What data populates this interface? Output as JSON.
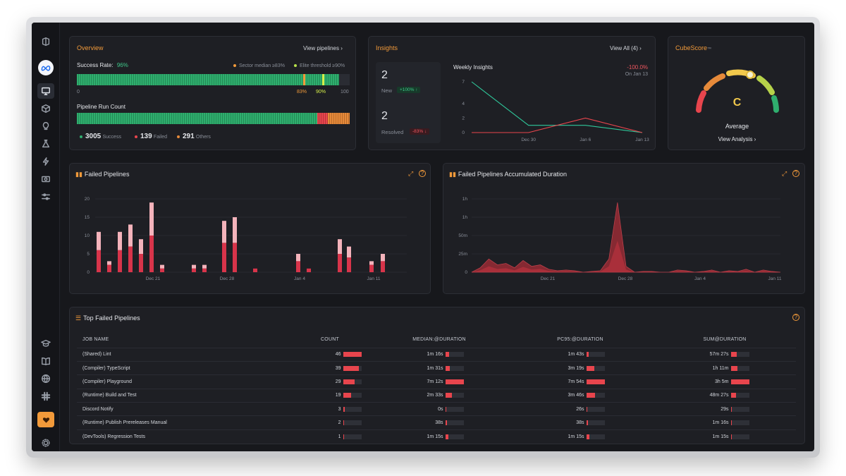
{
  "overview": {
    "title": "Overview",
    "view_link": "View pipelines",
    "success_label": "Success Rate:",
    "success_value": "96%",
    "sector_legend": "Sector median ≥83%",
    "elite_legend": "Elite threshold ≥90%",
    "axis_start": "0",
    "axis_83": "83%",
    "axis_90": "90%",
    "axis_end": "100",
    "run_count_label": "Pipeline Run Count",
    "success_count": "3005",
    "success_word": "Success",
    "failed_count": "139",
    "failed_word": "Failed",
    "other_count": "291",
    "other_word": "Others",
    "success_rate_fraction": 0.96,
    "run_share": {
      "success": 0.88,
      "failed": 0.04,
      "others": 0.08
    }
  },
  "insights": {
    "title": "Insights",
    "view_link": "View All (4)",
    "new_value": "2",
    "new_label": "New",
    "new_badge": "+100% ↑",
    "resolved_value": "2",
    "resolved_label": "Resolved",
    "resolved_badge": "-83% ↓",
    "chart_title": "Weekly Insights",
    "delta_value": "-100.0%",
    "delta_date": "On Jan 13"
  },
  "cubescore": {
    "title": "CubeScore",
    "title_suffix": "™",
    "grade": "C",
    "rating": "Average",
    "link": "View Analysis"
  },
  "failed_pipelines": {
    "title": "Failed Pipelines"
  },
  "accum_duration": {
    "title": "Failed Pipelines Accumulated Duration"
  },
  "top_failed": {
    "title": "Top Failed Pipelines",
    "headers": [
      "JOB NAME",
      "COUNT",
      "MEDIAN:@DURATION",
      "PC95:@DURATION",
      "SUM@DURATION"
    ],
    "rows": [
      {
        "name": "(Shared) Lint",
        "count": "46",
        "count_f": 1.0,
        "median": "1m 16s",
        "median_f": 0.2,
        "pc95": "1m 43s",
        "pc95_f": 0.1,
        "sum": "57m 27s",
        "sum_f": 0.3
      },
      {
        "name": "(Compiler) TypeScript",
        "count": "39",
        "count_f": 0.85,
        "median": "1m 31s",
        "median_f": 0.22,
        "pc95": "3m 19s",
        "pc95_f": 0.42,
        "sum": "1h 11m",
        "sum_f": 0.35
      },
      {
        "name": "(Compiler) Playground",
        "count": "29",
        "count_f": 0.63,
        "median": "7m 12s",
        "median_f": 1.0,
        "pc95": "7m 54s",
        "pc95_f": 1.0,
        "sum": "3h 5m",
        "sum_f": 1.0
      },
      {
        "name": "(Runtime) Build and Test",
        "count": "19",
        "count_f": 0.41,
        "median": "2m 33s",
        "median_f": 0.35,
        "pc95": "3m 46s",
        "pc95_f": 0.48,
        "sum": "48m 27s",
        "sum_f": 0.26
      },
      {
        "name": "Discord Notify",
        "count": "3",
        "count_f": 0.07,
        "median": "0s",
        "median_f": 0.0,
        "pc95": "26s",
        "pc95_f": 0.05,
        "sum": "29s",
        "sum_f": 0.01
      },
      {
        "name": "(Runtime) Publish Prereleases Manual",
        "count": "2",
        "count_f": 0.05,
        "median": "38s",
        "median_f": 0.09,
        "pc95": "38s",
        "pc95_f": 0.08,
        "sum": "1m 16s",
        "sum_f": 0.02
      },
      {
        "name": "(DevTools) Regression Tests",
        "count": "1",
        "count_f": 0.03,
        "median": "1m 15s",
        "median_f": 0.17,
        "pc95": "1m 15s",
        "pc95_f": 0.16,
        "sum": "1m 15s",
        "sum_f": 0.02
      }
    ]
  },
  "colors": {
    "accent": "#f29a3a",
    "success": "#2fae6e",
    "failed": "#e8454d",
    "failed_light": "#f4b3bb",
    "panel": "#1e1f24"
  },
  "chart_data": [
    {
      "type": "line",
      "title": "Weekly Insights",
      "categories": [
        "Dec 30",
        "Jan 6",
        "Jan 13"
      ],
      "x": [
        "Dec 23",
        "Dec 30",
        "Jan 6",
        "Jan 13"
      ],
      "ylim": [
        0,
        7
      ],
      "yticks": [
        "0",
        "2",
        "4",
        "7"
      ],
      "series": [
        {
          "name": "New",
          "values": [
            7,
            1,
            1,
            0
          ],
          "color": "#2fc79a"
        },
        {
          "name": "Resolved",
          "values": [
            0,
            0,
            2,
            0
          ],
          "color": "#e8454d"
        }
      ]
    },
    {
      "type": "bar",
      "title": "Failed Pipelines",
      "ylim": [
        0,
        20
      ],
      "yticks": [
        "0",
        "5",
        "10",
        "15",
        "20"
      ],
      "xticks": [
        "Dec 21",
        "Dec 28",
        "Jan 4",
        "Jan 11"
      ],
      "values": [
        11,
        3,
        11,
        13,
        9,
        19,
        2,
        0,
        2,
        2,
        0,
        14,
        15,
        1,
        0,
        0,
        5,
        1,
        0,
        9,
        7,
        3,
        5
      ],
      "positions": [
        0,
        1,
        2,
        3,
        4,
        5,
        6,
        7,
        8,
        9,
        10,
        11,
        12,
        13,
        14,
        15,
        16,
        17,
        18,
        19,
        20,
        21,
        22
      ],
      "dates": [
        "Dec 16",
        "Dec 17",
        "Dec 18",
        "Dec 19",
        "Dec 20",
        "Dec 21",
        "Dec 22",
        "Dec 23",
        "Dec 24",
        "Dec 25",
        "Dec 26",
        "Dec 27",
        "Dec 28",
        "Dec 29",
        "Dec 30",
        "Dec 31",
        "Jan 3",
        "Jan 4",
        "Jan 5",
        "Jan 7",
        "Jan 8",
        "Jan 9",
        "Jan 11"
      ]
    },
    {
      "type": "area",
      "title": "Failed Pipelines Accumulated Duration",
      "yticks": [
        "0",
        "25m",
        "50m",
        "1h",
        "1h"
      ],
      "xticks": [
        "Dec 21",
        "Dec 28",
        "Jan 4",
        "Jan 11"
      ],
      "unit": "minutes",
      "ylim": [
        0,
        100
      ],
      "values": [
        0,
        6,
        18,
        10,
        12,
        6,
        16,
        8,
        10,
        4,
        2,
        3,
        2,
        0,
        1,
        2,
        18,
        95,
        8,
        0,
        1,
        1,
        0,
        0,
        3,
        2,
        0,
        1,
        3,
        0,
        2,
        1,
        4,
        0,
        3,
        1,
        0
      ]
    }
  ]
}
